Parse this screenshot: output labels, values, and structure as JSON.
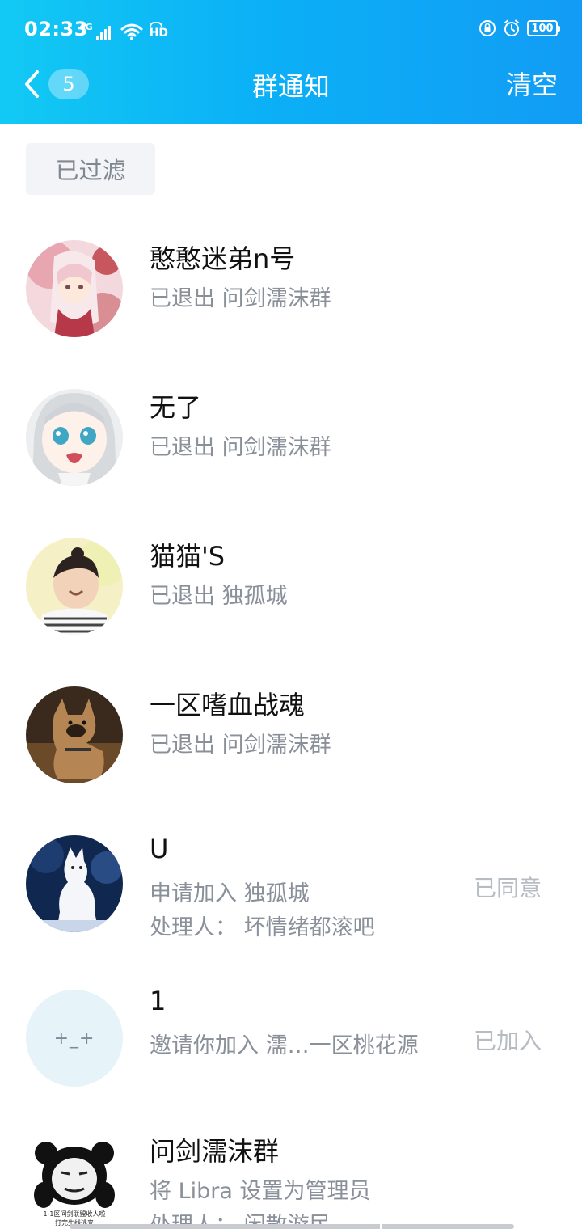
{
  "status_bar": {
    "time": "02:33",
    "network": "4G",
    "hd": "HD",
    "battery": "100",
    "icons": [
      "signal-icon",
      "wifi-icon",
      "hd-call-icon",
      "rotation-lock-icon",
      "alarm-icon",
      "battery-icon"
    ]
  },
  "nav": {
    "back_count": "5",
    "title": "群通知",
    "clear_label": "清空"
  },
  "filter": {
    "label": "已过滤"
  },
  "notifications": [
    {
      "name": "憨憨迷弟n号",
      "line1": "已退出 问剑濡沫群",
      "line2": "",
      "status": "",
      "avatar": "anime-girl-avatar"
    },
    {
      "name": "无了",
      "line1": "已退出 问剑濡沫群",
      "line2": "",
      "status": "",
      "avatar": "anime-crying-girl-avatar"
    },
    {
      "name": "猫猫'S",
      "line1": "已退出 独孤城",
      "line2": "",
      "status": "",
      "avatar": "child-photo-avatar"
    },
    {
      "name": "一区嗜血战魂",
      "line1": "已退出 问剑濡沫群",
      "line2": "",
      "status": "",
      "avatar": "dog-photo-avatar"
    },
    {
      "name": "U",
      "line1": "申请加入 独孤城",
      "line2": "处理人： 坏情绪都滚吧",
      "status": "已同意",
      "avatar": "white-fox-avatar"
    },
    {
      "name": "1",
      "line1": "邀请你加入 濡…一区桃花源",
      "line2": "",
      "status": "已加入",
      "avatar": "default-face-avatar",
      "avatar_text": "+_+"
    },
    {
      "name": "问剑濡沫群",
      "line1": "将 Libra 设置为管理员",
      "line2": "处理人： 闲散游民",
      "status": "",
      "avatar": "panda-meme-avatar",
      "avatar_caption_1": "1-1区问剑联盟收人啦",
      "avatar_caption_2": "打完生线逃来"
    }
  ],
  "colors": {
    "header_start": "#12c9f4",
    "header_end": "#129cf5",
    "subtitle": "#8a9099",
    "status_text": "#b7bcc2"
  }
}
